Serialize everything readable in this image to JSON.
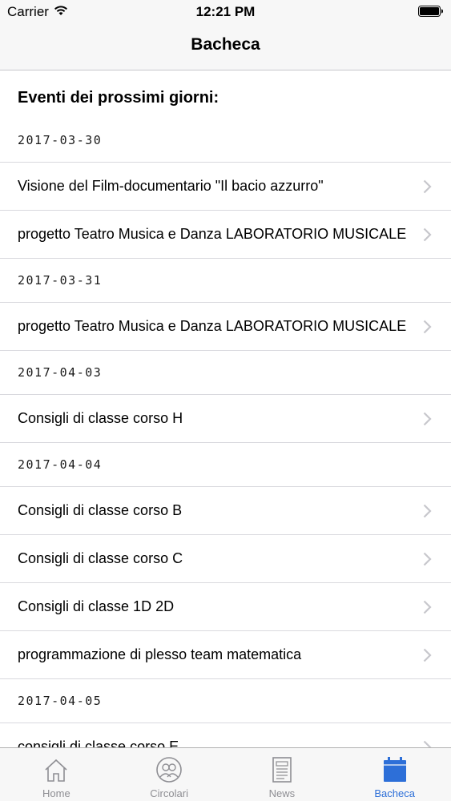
{
  "status_bar": {
    "carrier": "Carrier",
    "time": "12:21 PM"
  },
  "nav": {
    "title": "Bacheca"
  },
  "list": {
    "heading": "Eventi dei prossimi giorni:",
    "sections": [
      {
        "date": "2017-03-30",
        "items": [
          "Visione del Film-documentario \"Il bacio azzurro\"",
          "progetto Teatro Musica e Danza LABORATORIO MUSICALE"
        ]
      },
      {
        "date": "2017-03-31",
        "items": [
          "progetto Teatro Musica e Danza LABORATORIO MUSICALE"
        ]
      },
      {
        "date": "2017-04-03",
        "items": [
          "Consigli di classe corso H"
        ]
      },
      {
        "date": "2017-04-04",
        "items": [
          "Consigli di classe corso B",
          "Consigli di classe corso C",
          "Consigli di classe 1D 2D",
          "programmazione di plesso team matematica"
        ]
      },
      {
        "date": "2017-04-05",
        "items": [
          "consigli di classe corso E"
        ]
      }
    ]
  },
  "tab_bar": {
    "tabs": [
      {
        "label": "Home",
        "icon": "home-icon",
        "active": false
      },
      {
        "label": "Circolari",
        "icon": "people-icon",
        "active": false
      },
      {
        "label": "News",
        "icon": "newspaper-icon",
        "active": false
      },
      {
        "label": "Bacheca",
        "icon": "calendar-icon",
        "active": true
      }
    ]
  },
  "colors": {
    "accent": "#2d6fd8",
    "inactive_tab": "#8e8e93",
    "separator": "#d9d9de"
  }
}
